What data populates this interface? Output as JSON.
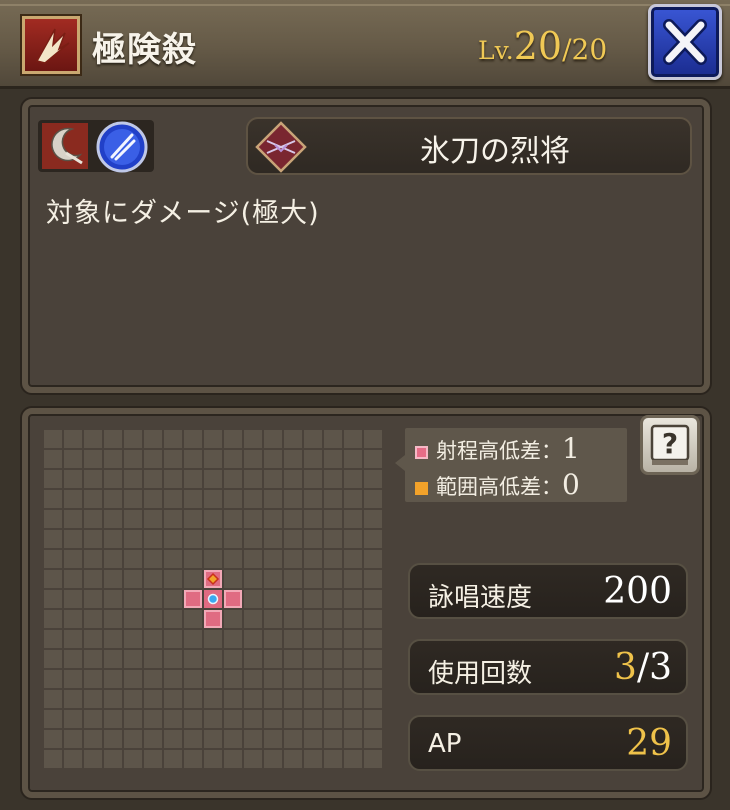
{
  "header": {
    "skill_icon": "claw-slash-icon",
    "title": "極険殺",
    "level_label": "Lv.",
    "level_current": "20",
    "level_max": "/20",
    "close_icon": "close-x-icon"
  },
  "skill_info": {
    "element_icon": "dark-crescent-icon",
    "type_icon": "blue-slash-orb-icon",
    "job_icon": "crossed-blades-emblem-icon",
    "job_name": "氷刀の烈将",
    "description": "対象にダメージ(極大)"
  },
  "range": {
    "grid_size": 17,
    "range_height_label": "射程高低差：",
    "range_height_value": "1",
    "area_height_label": "範囲高低差：",
    "area_height_value": "0",
    "help_icon": "question-book-icon"
  },
  "stats": {
    "cast_speed_label": "詠唱速度",
    "cast_speed_value": "200",
    "uses_label": "使用回数",
    "uses_current": "3",
    "uses_max": "/3",
    "ap_label": "AP",
    "ap_value": "29"
  },
  "colors": {
    "level_gold": "#f0c955",
    "target_pink": "#e06b82",
    "area_orange": "#f2a22a",
    "close_blue": "#2b45c4"
  }
}
